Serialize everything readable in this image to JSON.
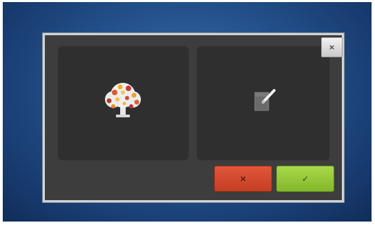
{
  "dialog": {
    "close_label": "×",
    "cancel_label": "×",
    "confirm_label": "✓",
    "options": [
      {
        "icon": "embroidery-tree-design-icon"
      },
      {
        "icon": "edit-design-pen-icon"
      }
    ]
  },
  "colors": {
    "background_blue": "#23508a",
    "dialog_bg": "#3d3d3d",
    "panel_bg": "#2f2f2f",
    "cancel_red": "#d04a2e",
    "confirm_green": "#96c83a"
  }
}
